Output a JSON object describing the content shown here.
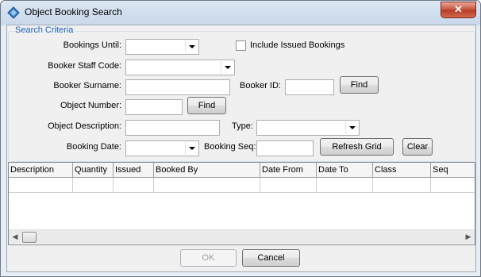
{
  "window": {
    "title": "Object Booking Search",
    "close_symbol": "✕"
  },
  "criteria": {
    "legend": "Search Criteria",
    "bookings_until_label": "Bookings Until:",
    "include_issued_label": "Include Issued Bookings",
    "booker_staff_code_label": "Booker Staff Code:",
    "booker_surname_label": "Booker Surname:",
    "booker_id_label": "Booker ID:",
    "find_label": "Find",
    "object_number_label": "Object Number:",
    "find2_label": "Find",
    "object_description_label": "Object Description:",
    "type_label": "Type:",
    "booking_date_label": "Booking Date:",
    "booking_seq_label": "Booking Seq:",
    "refresh_label": "Refresh Grid",
    "clear_label": "Clear"
  },
  "grid": {
    "columns": [
      "Description",
      "Quantity",
      "Issued",
      "Booked By",
      "Date From",
      "Date To",
      "Class",
      "Seq"
    ]
  },
  "footer": {
    "ok_label": "OK",
    "cancel_label": "Cancel"
  }
}
